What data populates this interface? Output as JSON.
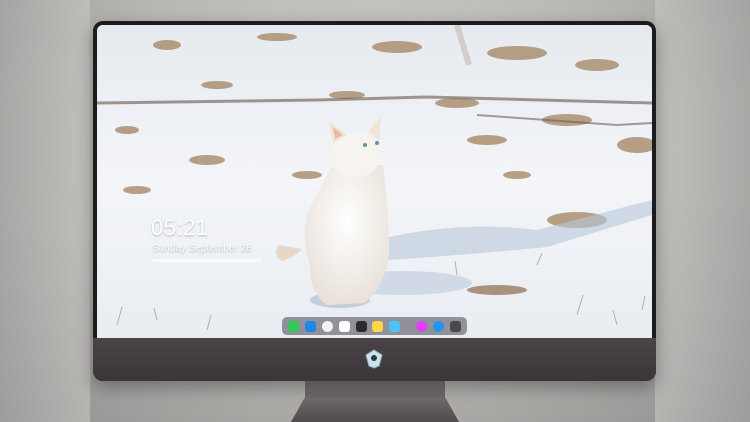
{
  "lockscreen": {
    "time": "05:21",
    "date": "Sunday September 28"
  },
  "dock": {
    "icons": [
      {
        "name": "messages-icon",
        "color": "#34c759"
      },
      {
        "name": "finder-icon",
        "color": "#1e88e5"
      },
      {
        "name": "clock-icon",
        "color": "#f2f2f2"
      },
      {
        "name": "calendar-icon",
        "color": "#ffffff"
      },
      {
        "name": "clapper-icon",
        "color": "#2c2c2c"
      },
      {
        "name": "notes-icon",
        "color": "#ffd54a"
      },
      {
        "name": "photos-icon",
        "color": "#4fc3f7"
      },
      {
        "name": "itunes-icon",
        "color": "#e040fb"
      },
      {
        "name": "app-store-icon",
        "color": "#2196f3"
      },
      {
        "name": "camera-icon",
        "color": "#4a4a4a"
      }
    ]
  },
  "colors": {
    "bezel": "#1c1c1e",
    "chin": "#3f3a3d",
    "snow": "#f1f3f6"
  }
}
